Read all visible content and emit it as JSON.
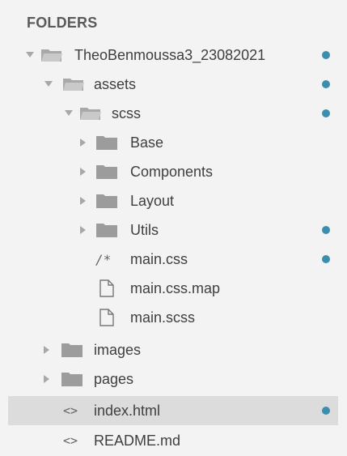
{
  "explorer": {
    "section_title": "FOLDERS",
    "modified_dot_color": "#3b8ead",
    "items": [
      {
        "label": "TheoBenmoussa3_23082021",
        "kind": "folder",
        "expanded": true,
        "modified": true
      },
      {
        "label": "assets",
        "kind": "folder",
        "expanded": true,
        "modified": true
      },
      {
        "label": "scss",
        "kind": "folder",
        "expanded": true,
        "modified": true
      },
      {
        "label": "Base",
        "kind": "folder",
        "expanded": false,
        "modified": false
      },
      {
        "label": "Components",
        "kind": "folder",
        "expanded": false,
        "modified": false
      },
      {
        "label": "Layout",
        "kind": "folder",
        "expanded": false,
        "modified": false
      },
      {
        "label": "Utils",
        "kind": "folder",
        "expanded": false,
        "modified": true
      },
      {
        "label": "main.css",
        "kind": "file",
        "icon": "css-comment-icon",
        "modified": true
      },
      {
        "label": "main.css.map",
        "kind": "file",
        "icon": "file-icon",
        "modified": false
      },
      {
        "label": "main.scss",
        "kind": "file",
        "icon": "file-icon",
        "modified": false
      },
      {
        "label": "images",
        "kind": "folder",
        "expanded": false,
        "modified": false
      },
      {
        "label": "pages",
        "kind": "folder",
        "expanded": false,
        "modified": false
      },
      {
        "label": "index.html",
        "kind": "file",
        "icon": "code-icon",
        "modified": true,
        "selected": true
      },
      {
        "label": "README.md",
        "kind": "file",
        "icon": "code-icon",
        "modified": false
      }
    ]
  }
}
